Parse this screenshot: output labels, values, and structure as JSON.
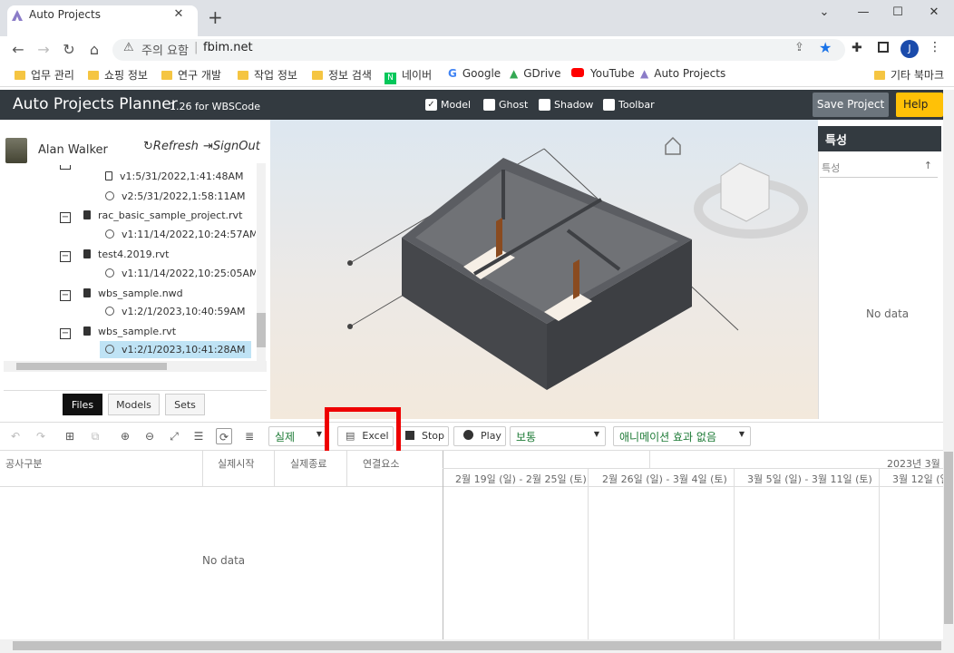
{
  "browser": {
    "tab_title": "Auto Projects",
    "tab_close": "✕",
    "new_tab": "+",
    "window_buttons": [
      "⌄",
      "—",
      "☐",
      "✕"
    ],
    "security_label": "주의 요함",
    "url": "fbim.net",
    "bookmarks": [
      "업무 관리",
      "쇼핑 정보",
      "연구 개발",
      "작업 정보",
      "정보 검색",
      "네이버",
      "Google",
      "GDrive",
      "YouTube",
      "Auto Projects",
      "기타 북마크"
    ],
    "profile_initial": "J"
  },
  "app": {
    "title": "Auto Projects Planner",
    "version": "1.26 for WBSCode",
    "checkboxes": [
      {
        "label": "Model",
        "checked": true
      },
      {
        "label": "Ghost",
        "checked": false
      },
      {
        "label": "Shadow",
        "checked": false
      },
      {
        "label": "Toolbar",
        "checked": false
      }
    ],
    "save_label": "Save Project",
    "help_label": "Help De"
  },
  "user": {
    "name": "Alan Walker",
    "refresh": "Refresh",
    "signout": "SignOut"
  },
  "tree": {
    "v1": "v1:5/31/2022,1:41:48AM",
    "v2": "v2:5/31/2022,1:58:11AM",
    "rac": "rac_basic_sample_project.rvt",
    "rac_v": "v1:11/14/2022,10:24:57AM",
    "test": "test4.2019.rvt",
    "test_v": "v1:11/14/2022,10:25:05AM",
    "nwd": "wbs_sample.nwd",
    "nwd_v": "v1:2/1/2023,10:40:59AM",
    "rvt": "wbs_sample.rvt",
    "rvt_v": "v1:2/1/2023,10:41:28AM"
  },
  "panel_tabs": [
    "Files",
    "Models",
    "Sets"
  ],
  "props": {
    "title": "특성",
    "search_placeholder": "특성",
    "no_data": "No data"
  },
  "toolbar": {
    "mode": "실제",
    "excel": "Excel",
    "stop": "Stop",
    "play": "Play",
    "speed": "보통",
    "animation": "애니메이션 효과 없음"
  },
  "grid": {
    "columns": [
      "공사구분",
      "실제시작",
      "실제종료",
      "연결요소"
    ],
    "month": "2023년 3월",
    "weeks": [
      "2월 19일 (일) - 2월 25일 (토)",
      "2월 26일 (일) - 3월 4일 (토)",
      "3월 5일 (일) - 3월 11일 (토)",
      "3월 12일 (일"
    ],
    "no_data": "No data"
  },
  "colors": {
    "header_bg": "#333a40",
    "accent": "#ffc107",
    "highlight": "#ee0000"
  }
}
